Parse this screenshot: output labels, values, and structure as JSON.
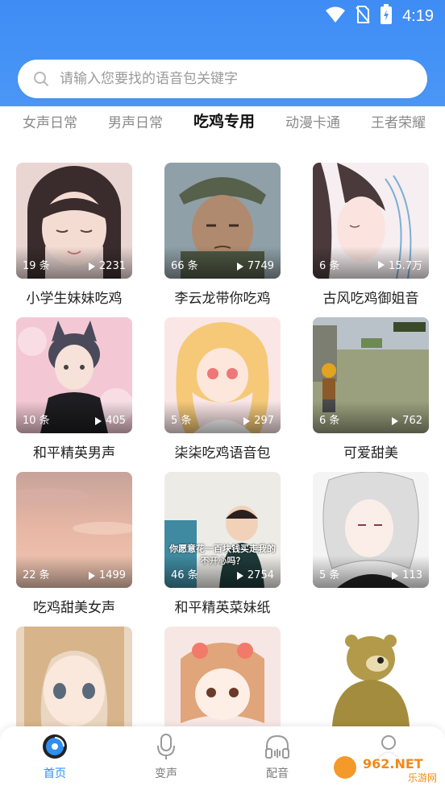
{
  "status_bar": {
    "time": "4:19",
    "icons": [
      "wifi-icon",
      "no-sim-icon",
      "battery-charging-icon"
    ]
  },
  "search": {
    "placeholder": "请输入您要找的语音包关键字",
    "icon": "search-icon"
  },
  "tabs": [
    {
      "label": "女声日常",
      "active": false
    },
    {
      "label": "男声日常",
      "active": false
    },
    {
      "label": "吃鸡专用",
      "active": true
    },
    {
      "label": "动漫卡通",
      "active": false
    },
    {
      "label": "王者荣耀",
      "active": false
    }
  ],
  "cards": [
    {
      "count": "19 条",
      "plays": "2231",
      "title": "小学生妹妹吃鸡",
      "image": "girl-portrait"
    },
    {
      "count": "66 条",
      "plays": "7749",
      "title": "李云龙带你吃鸡",
      "image": "soldier-portrait"
    },
    {
      "count": "6 条",
      "plays": "15.7万",
      "title": "古风吃鸡御姐音",
      "image": "ancient-style-girl"
    },
    {
      "count": "10 条",
      "plays": "405",
      "title": "和平精英男声",
      "image": "anime-catboy"
    },
    {
      "count": "5 条",
      "plays": "297",
      "title": "柒柒吃鸡语音包",
      "image": "anime-blonde-girl"
    },
    {
      "count": "6 条",
      "plays": "762",
      "title": "可爱甜美",
      "image": "game-character"
    },
    {
      "count": "22 条",
      "plays": "1499",
      "title": "吃鸡甜美女声",
      "image": "sunset-sky"
    },
    {
      "count": "46 条",
      "plays": "2754",
      "title": "和平精英菜妹纸",
      "image": "baby-photo",
      "caption": "你愿意花一百块钱买走我的不开心吗？"
    },
    {
      "count": "5 条",
      "plays": "113",
      "title": "",
      "image": "white-hair-anime"
    },
    {
      "count": "",
      "plays": "",
      "title": "",
      "image": "anime-girl-brown-hair"
    },
    {
      "count": "",
      "plays": "",
      "title": "",
      "image": "chibi-girl"
    },
    {
      "count": "",
      "plays": "",
      "title": "",
      "image": "cartoon-bear"
    }
  ],
  "bottom_nav": [
    {
      "label": "首页",
      "icon": "home-record-icon",
      "active": true
    },
    {
      "label": "变声",
      "icon": "microphone-icon",
      "active": false
    },
    {
      "label": "配音",
      "icon": "headphones-icon",
      "active": false
    },
    {
      "label": "",
      "icon": "profile-icon",
      "active": false
    }
  ],
  "watermark": {
    "text": "962.NET",
    "subtext": "乐游网"
  },
  "colors": {
    "accent": "#2e8ef2",
    "header": "#3f8cf5"
  }
}
